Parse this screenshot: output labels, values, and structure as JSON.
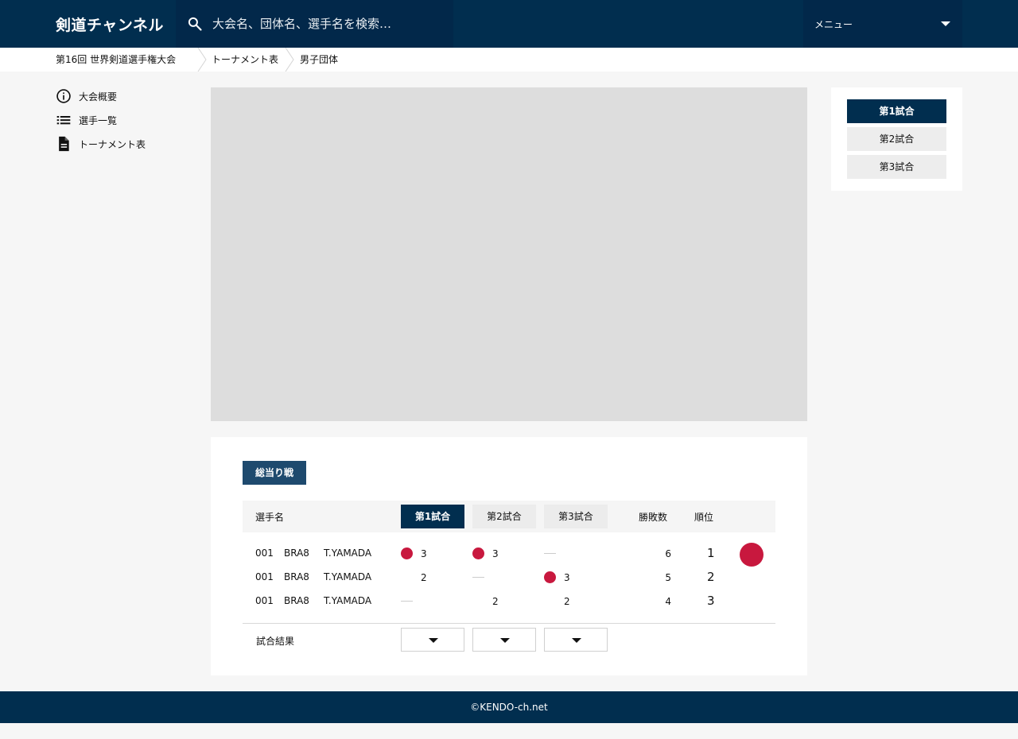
{
  "header": {
    "logo": "剣道チャンネル",
    "search_placeholder": "大会名、団体名、選手名を検索…",
    "menu_label": "メニュー",
    "search_icon": "search-icon",
    "menu_icon": "caret-down-icon"
  },
  "breadcrumb": [
    "第16回 世界剣道選手権大会",
    "トーナメント表",
    "男子団体"
  ],
  "sidebar": {
    "items": [
      {
        "label": "大会概要",
        "icon": "info-icon"
      },
      {
        "label": "選手一覧",
        "icon": "list-icon"
      },
      {
        "label": "トーナメント表",
        "icon": "document-icon"
      }
    ]
  },
  "match_nav": {
    "items": [
      "第1試合",
      "第2試合",
      "第3試合"
    ],
    "active": 0
  },
  "league": {
    "badge": "総当り戦",
    "headers": {
      "name": "選手名",
      "wins": "勝敗数",
      "rank": "順位"
    },
    "match_tabs": [
      "第1試合",
      "第2試合",
      "第3試合"
    ],
    "active_tab": 0,
    "rows": [
      {
        "num": "001",
        "country": "BRA8",
        "player": "T.YAMADA",
        "scores": [
          {
            "mark": "dot",
            "value": "3"
          },
          {
            "mark": "dot",
            "value": "3"
          },
          {
            "mark": "dash",
            "value": ""
          }
        ],
        "wins": "6",
        "rank": "1"
      },
      {
        "num": "001",
        "country": "BRA8",
        "player": "T.YAMADA",
        "scores": [
          {
            "mark": "none",
            "value": "2"
          },
          {
            "mark": "dash",
            "value": ""
          },
          {
            "mark": "dot",
            "value": "3"
          }
        ],
        "wins": "5",
        "rank": "2"
      },
      {
        "num": "001",
        "country": "BRA8",
        "player": "T.YAMADA",
        "scores": [
          {
            "mark": "dash",
            "value": ""
          },
          {
            "mark": "none",
            "value": "2"
          },
          {
            "mark": "none",
            "value": "2"
          }
        ],
        "wins": "4",
        "rank": "3"
      }
    ],
    "result_label": "試合結果",
    "accent_color": "#c8183e"
  },
  "footer": {
    "copyright": "©KENDO-ch.net"
  },
  "colors": {
    "navy": "#012e4f",
    "badge": "#1e4a6e",
    "red": "#c8183e"
  }
}
